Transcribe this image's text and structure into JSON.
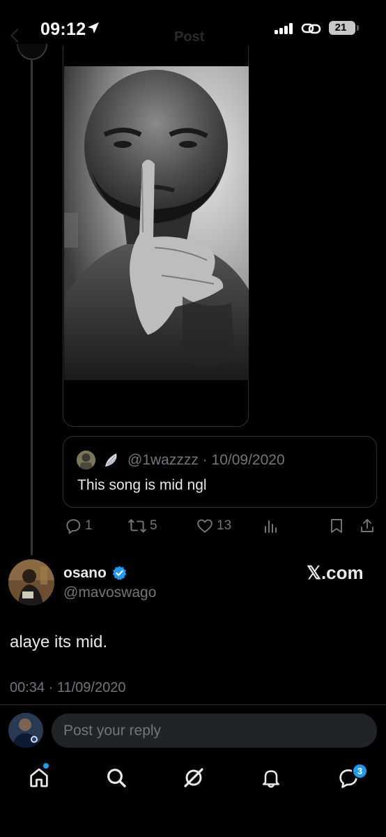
{
  "status_bar": {
    "time": "09:12",
    "battery": "21",
    "ghost_title": "Post"
  },
  "quoted_post": {
    "handle": "@1wazzzz",
    "date": "10/09/2020",
    "text": "This song is mid ngl"
  },
  "actions": {
    "replies": "1",
    "reposts": "5",
    "likes": "13"
  },
  "main_post": {
    "display_name": "osano",
    "handle": "@mavoswago",
    "watermark": "𝕏.com",
    "text": "alaye its mid.",
    "timestamp": "00:34 · 11/09/2020"
  },
  "reply_bar": {
    "placeholder": "Post your reply"
  },
  "tab_bar": {
    "messages_badge": "3"
  },
  "colors": {
    "background": "#000000",
    "text_primary": "#e7e9ea",
    "text_secondary": "#71767b",
    "border": "#2f3336",
    "accent": "#1d9bf0",
    "input_bg": "#202327"
  },
  "icons": {
    "status": [
      "location-arrow-icon",
      "signal-icon",
      "link-icon",
      "battery-icon"
    ],
    "post_actions": [
      "reply-icon",
      "repost-icon",
      "like-icon",
      "views-icon",
      "bookmark-icon",
      "share-icon"
    ],
    "tabs": [
      "home-icon",
      "search-icon",
      "grok-icon",
      "notifications-icon",
      "messages-icon"
    ]
  }
}
